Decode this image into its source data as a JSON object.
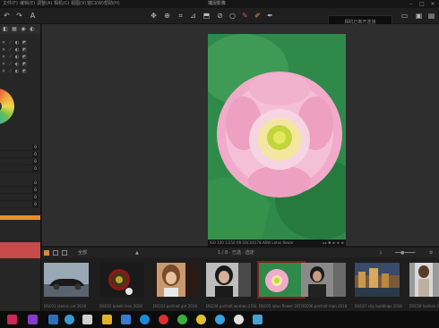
{
  "app": {
    "title": "捕捉影像"
  },
  "menus": [
    "文件(F)",
    "编辑(E)",
    "调整(A)",
    "相机(C)",
    "视图(V)",
    "窗口(W)",
    "帮助(H)"
  ],
  "toolbar": {
    "icons": [
      "undo-icon",
      "redo-icon",
      "text-icon",
      "move-icon",
      "zoom-icon",
      "crop-icon",
      "straighten-icon",
      "keystone-icon",
      "spot-icon",
      "brush-icon",
      "erase-icon",
      "picker-icon"
    ],
    "connect_label": "相机已断开连接"
  },
  "left_panel": {
    "tabs": [
      "camera-tab",
      "library-tab",
      "capture-tab",
      "adjust-tab"
    ],
    "tool_rows": [
      "✕ ⟋ ◐ ◩",
      "✕ ⟋ ◐ ◩",
      "✕ ⟋ ◐ ◩",
      "✕ ⟋ ◐ ◩",
      "✕ ⟋ ◐ ◩"
    ],
    "slider_values": [
      "0",
      "0",
      "0",
      "0",
      "0",
      "0",
      "0",
      "0"
    ]
  },
  "viewer": {
    "info": "ISO 100  1/250 f/8  DSC04178.ARW  Lotus flower",
    "info_icons": "◂ ▸ ✱ ★ ★ ★"
  },
  "browser": {
    "label": "全部",
    "count": "1 / 8 · 已选 · 选定",
    "sort": "▲"
  },
  "filmstrip": {
    "thumbnails": [
      {
        "caption": "DSC01 classic car 2018"
      },
      {
        "caption": "DSC02 bokeh lens 2018"
      },
      {
        "caption": "DSC03 portrait girl 2018"
      },
      {
        "caption": "DSC04 portrait woman 2018"
      },
      {
        "caption": "DSC05 lotus flower 2018"
      },
      {
        "caption": "DSC06 portrait man 2018"
      },
      {
        "caption": "DSC07 city buildings 2018"
      },
      {
        "caption": "DSC08 fashion 2018"
      }
    ]
  },
  "taskbar": {
    "icons": [
      "start-icon",
      "search-icon",
      "pr-app-icon",
      "ps-app-icon",
      "ie-icon",
      "store-icon",
      "folder-icon",
      "mail-icon",
      "edge-icon",
      "record-icon",
      "wechat-icon",
      "chrome-icon",
      "qq-icon",
      "info-icon",
      "camera-icon"
    ],
    "colors": [
      "#c8285a",
      "#8a3ac8",
      "#2a6fb8",
      "#1d6fb0",
      "#3a9ad0",
      "#d0d0d0",
      "#e0b030",
      "#3a7ad0",
      "#1a8ad8",
      "#d83030",
      "#3ab040",
      "#e0c030",
      "#3aa0e0",
      "#e0e0e0",
      "#4aa0d0"
    ]
  },
  "colors": {
    "accent": "#e8902a",
    "selection": "#8a1c1c",
    "panel": "#262626",
    "viewer_bg": "#2e2e2e"
  }
}
